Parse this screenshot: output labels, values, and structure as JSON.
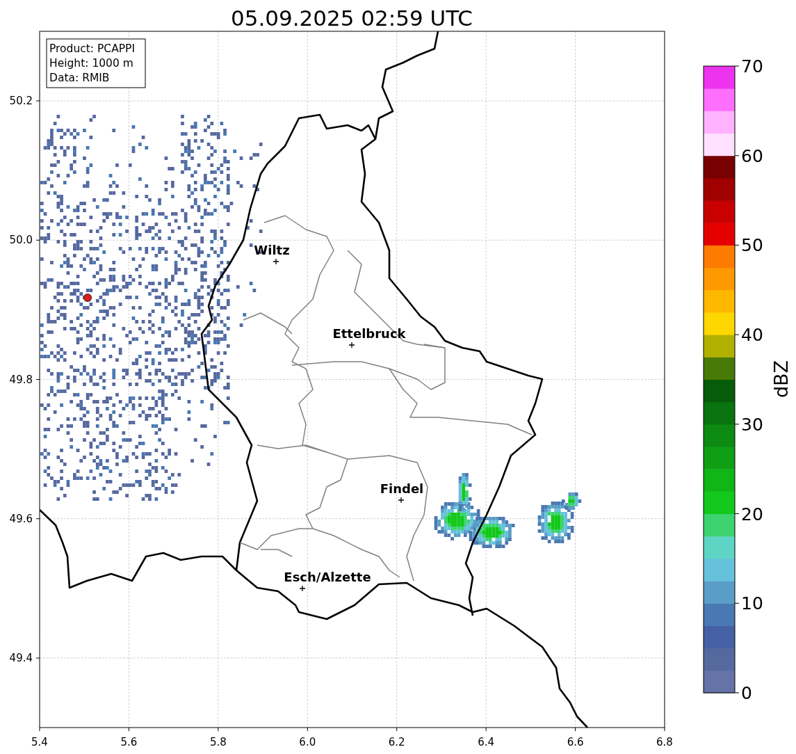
{
  "title": "05.09.2025 02:59 UTC",
  "info_box": [
    "Product: PCAPPI",
    "Height: 1000 m",
    "Data: RMIB"
  ],
  "map": {
    "xticks": [
      "5.4",
      "5.6",
      "5.8",
      "6.0",
      "6.2",
      "6.4",
      "6.6",
      "6.8"
    ],
    "yticks": [
      "50.2",
      "50.0",
      "49.8",
      "49.6",
      "49.4"
    ],
    "cities": [
      {
        "name": "Wiltz"
      },
      {
        "name": "Ettelbruck"
      },
      {
        "name": "Findel"
      },
      {
        "name": "Esch/Alzette"
      }
    ]
  },
  "colorbar": {
    "label": "dBZ",
    "ticks": [
      "70",
      "60",
      "50",
      "40",
      "30",
      "20",
      "10",
      "0"
    ],
    "bands": [
      {
        "color": "#6573a8"
      },
      {
        "color": "#56699f"
      },
      {
        "color": "#4660a6"
      },
      {
        "color": "#4a78b2"
      },
      {
        "color": "#5a9dc6"
      },
      {
        "color": "#66c2dc"
      },
      {
        "color": "#5ed5c4"
      },
      {
        "color": "#3dd36f"
      },
      {
        "color": "#12c81a"
      },
      {
        "color": "#10b516"
      },
      {
        "color": "#0e9f14"
      },
      {
        "color": "#0c8a12"
      },
      {
        "color": "#0a7410"
      },
      {
        "color": "#065c0a"
      },
      {
        "color": "#477a07"
      },
      {
        "color": "#b0b000"
      },
      {
        "color": "#ffd700"
      },
      {
        "color": "#ffb800"
      },
      {
        "color": "#ff9900"
      },
      {
        "color": "#ff7b00"
      },
      {
        "color": "#e50000"
      },
      {
        "color": "#c80000"
      },
      {
        "color": "#a00000"
      },
      {
        "color": "#780000"
      },
      {
        "color": "#ffe0ff"
      },
      {
        "color": "#ffb2ff"
      },
      {
        "color": "#ff6eff"
      },
      {
        "color": "#ee33ee"
      }
    ]
  }
}
